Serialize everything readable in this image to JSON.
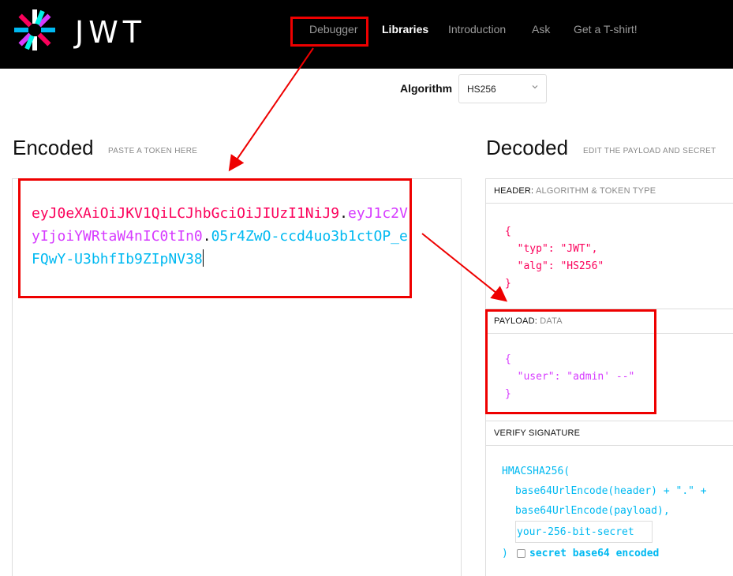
{
  "header": {
    "logo_text": "JWT",
    "nav": [
      "Debugger",
      "Libraries",
      "Introduction",
      "Ask",
      "Get a T-shirt!"
    ],
    "active_nav": "Libraries"
  },
  "algorithm": {
    "label": "Algorithm",
    "value": "HS256"
  },
  "encoded": {
    "title": "Encoded",
    "subtitle": "PASTE A TOKEN HERE",
    "token_header": "eyJ0eXAiOiJKV1QiLCJhbGciOiJIUzI1NiJ9",
    "token_payload": "eyJ1c2VyIjoiYWRtaW4nIC0tIn0",
    "token_signature": "05r4ZwO-ccd4uo3b1ctOP_eFQwY-U3bhfIb9ZIpNV38",
    "dot": "."
  },
  "decoded": {
    "title": "Decoded",
    "subtitle": "EDIT THE PAYLOAD AND SECRET",
    "header_label": "HEADER:",
    "header_sub": "ALGORITHM & TOKEN TYPE",
    "header_json": "{\n  \"typ\": \"JWT\",\n  \"alg\": \"HS256\"\n}",
    "payload_label": "PAYLOAD:",
    "payload_sub": "DATA",
    "payload_json": "{\n  \"user\": \"admin' --\"\n}",
    "verify_label": "VERIFY SIGNATURE",
    "verify_line1": "HMACSHA256(",
    "verify_line2": "base64UrlEncode(header) + \".\" +",
    "verify_line3": "base64UrlEncode(payload),",
    "secret_value": "your-256-bit-secret",
    "close_paren": ")",
    "base64_label": "secret base64 encoded"
  },
  "colors": {
    "header": "#fb015b",
    "payload": "#d63aff",
    "signature": "#00b9f1",
    "annotation": "#e00000"
  }
}
